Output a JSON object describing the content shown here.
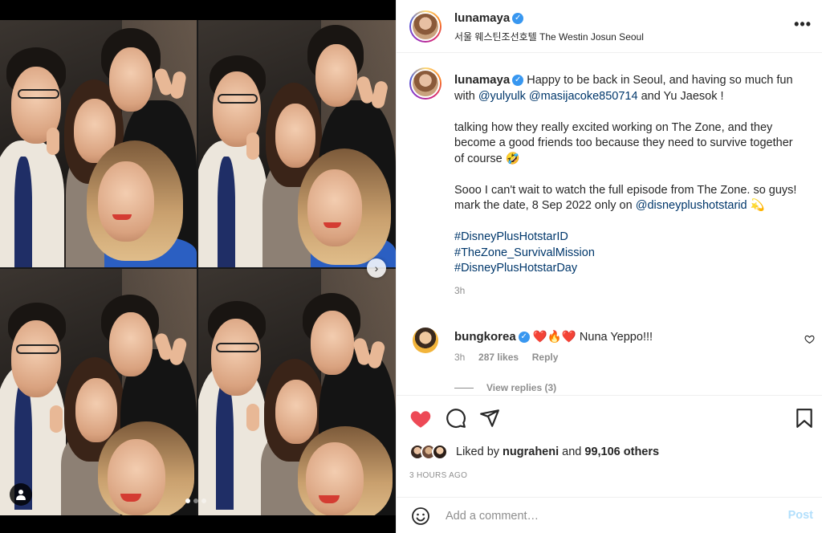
{
  "post": {
    "author": "lunamaya",
    "location": "서울 웨스틴조선호텔 The Westin Josun Seoul",
    "more_label": "•••"
  },
  "caption": {
    "author": "lunamaya",
    "p1": [
      "Happy to be back in Seoul, and having so much fun with ",
      "@yulyulk",
      " ",
      "@masijacoke850714",
      " and Yu Jaesok !"
    ],
    "p2": "talking how they really excited working on The Zone, and they become a good friends too because they need to survive together of course 🤣",
    "p3": [
      "Sooo I can't wait to watch the full episode from The Zone. so guys! mark the date, 8 Sep 2022 only on ",
      "@disneyplushotstarid",
      " 💫"
    ],
    "hashtags": [
      "#DisneyPlusHotstarID",
      "#TheZone_SurvivalMission",
      "#DisneyPlusHotstarDay"
    ],
    "time": "3h"
  },
  "comment": {
    "author": "bungkorea",
    "text": "❤️🔥❤️ Nuna Yeppo!!!",
    "time": "3h",
    "likes": "287 likes",
    "reply_label": "Reply",
    "view_replies": "View replies (3)"
  },
  "likes": {
    "liked_by_prefix": "Liked by ",
    "liked_by_user": "nugraheni",
    "and": " and ",
    "others": "99,106 others"
  },
  "timestamp": "3 HOURS AGO",
  "comment_input": {
    "placeholder": "Add a comment…",
    "post_label": "Post"
  },
  "media": {
    "dots": 3,
    "active_dot": 0
  },
  "colors": {
    "like_red": "#ed4956",
    "link_blue": "#00376b",
    "verified_blue": "#3897f0",
    "post_button": "#b2dffc"
  }
}
